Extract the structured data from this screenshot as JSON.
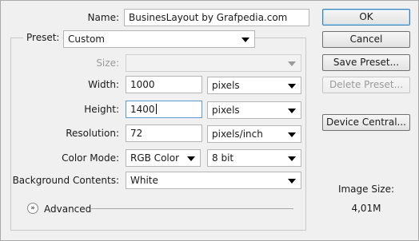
{
  "name": {
    "label": "Name:",
    "value": "BusinesLayout by Grafpedia.com"
  },
  "preset": {
    "label": "Preset:",
    "value": "Custom"
  },
  "size": {
    "label": "Size:",
    "value": ""
  },
  "width": {
    "label": "Width:",
    "value": "1000",
    "unit": "pixels"
  },
  "height": {
    "label": "Height:",
    "value": "1400",
    "unit": "pixels"
  },
  "resolution": {
    "label": "Resolution:",
    "value": "72",
    "unit": "pixels/inch"
  },
  "color_mode": {
    "label": "Color Mode:",
    "mode": "RGB Color",
    "depth": "8 bit"
  },
  "background": {
    "label": "Background Contents:",
    "value": "White"
  },
  "advanced": {
    "label": "Advanced"
  },
  "buttons": {
    "ok": "OK",
    "cancel": "Cancel",
    "save_preset": "Save Preset...",
    "delete_preset": "Delete Preset...",
    "device_central": "Device Central..."
  },
  "image_size": {
    "label": "Image Size:",
    "value": "4,01M"
  }
}
